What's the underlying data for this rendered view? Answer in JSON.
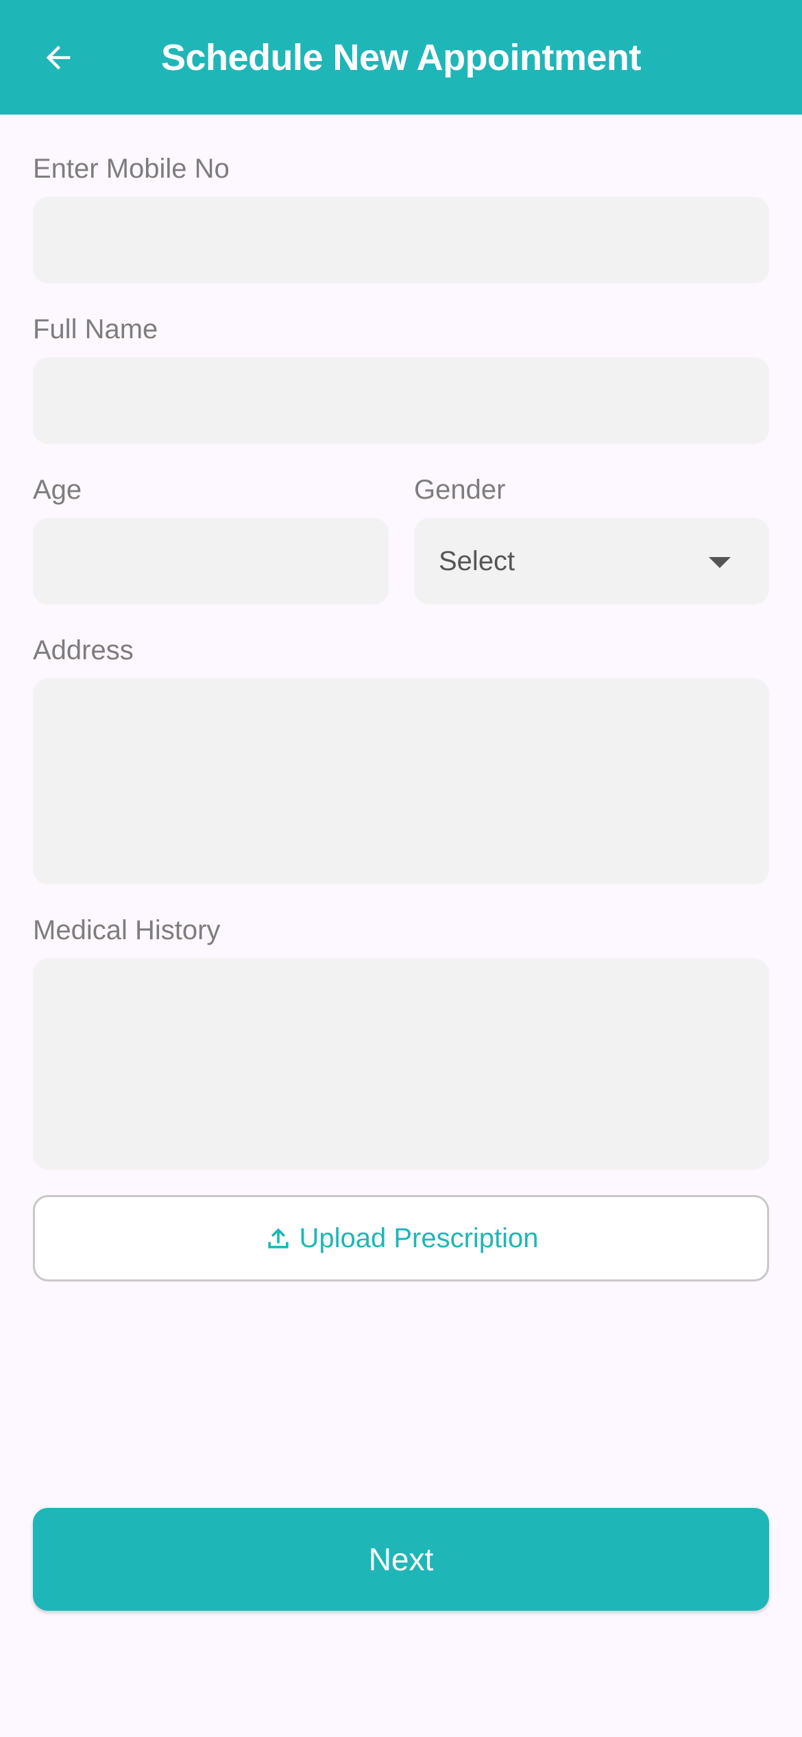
{
  "app_bar": {
    "title": "Schedule New Appointment",
    "back_icon": "arrow-left-icon"
  },
  "form": {
    "mobile": {
      "label": "Enter Mobile No",
      "value": ""
    },
    "full_name": {
      "label": "Full Name",
      "value": ""
    },
    "age": {
      "label": "Age",
      "value": ""
    },
    "gender": {
      "label": "Gender",
      "selected": "Select",
      "icon": "caret-down-icon"
    },
    "address": {
      "label": "Address",
      "value": ""
    },
    "medical_history": {
      "label": "Medical History",
      "value": ""
    }
  },
  "upload": {
    "label": "Upload Prescription",
    "icon": "upload-icon"
  },
  "next": {
    "label": "Next"
  },
  "colors": {
    "primary": "#1fb6b8",
    "background": "#fdf7ff",
    "field_background": "#f2f2f2",
    "label_text": "#7d7d7d"
  }
}
